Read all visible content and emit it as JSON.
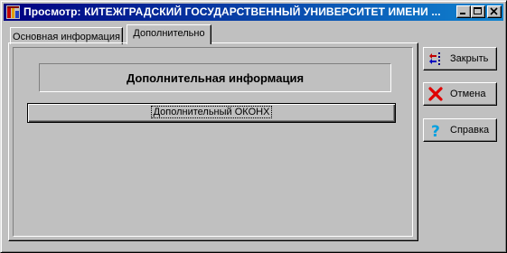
{
  "window": {
    "title": "Просмотр: КИТЕЖГРАДСКИЙ ГОСУДАРСТВЕННЫЙ УНИВЕРСИТЕТ ИМЕНИ ..."
  },
  "tabs": [
    {
      "label": "Основная информация",
      "active": false
    },
    {
      "label": "Дополнительно",
      "active": true
    }
  ],
  "panel": {
    "section_title": "Дополнительная информация",
    "okonh_button": "Дополнительный ОКОНХ"
  },
  "side_buttons": {
    "close": {
      "label": "Закрыть",
      "icon": "close-arrows-icon"
    },
    "cancel": {
      "label": "Отмена",
      "icon": "red-x-icon"
    },
    "help": {
      "label": "Справка",
      "icon": "question-mark-icon"
    }
  },
  "colors": {
    "face": "#c0c0c0",
    "title_start": "#000080",
    "title_end": "#1084d0",
    "cancel_red": "#e00000",
    "help_blue": "#00a0e0"
  }
}
